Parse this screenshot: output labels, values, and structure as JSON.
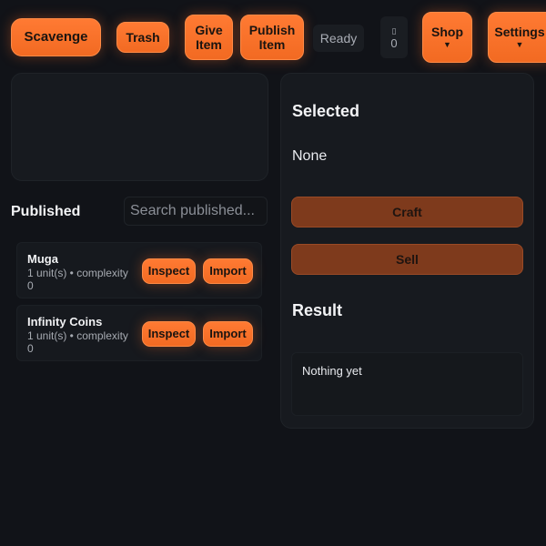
{
  "toolbar": {
    "scavenge_label": "Scavenge",
    "trash_label": "Trash",
    "give_item_line1": "Give",
    "give_item_line2": "Item",
    "publish_item_line1": "Publish",
    "publish_item_line2": "Item",
    "status_text": "Ready",
    "counter_icon_glyph": "▯",
    "counter_value": "0",
    "shop_label": "Shop",
    "settings_label": "Settings",
    "caret": "▼"
  },
  "published": {
    "title": "Published",
    "search_placeholder": "Search published...",
    "items": [
      {
        "name": "Muga",
        "meta": "1 unit(s) • complexity 0",
        "inspect_label": "Inspect",
        "import_label": "Import"
      },
      {
        "name": "Infinity Coins",
        "meta": "1 unit(s) • complexity 0",
        "inspect_label": "Inspect",
        "import_label": "Import"
      }
    ]
  },
  "selected": {
    "title": "Selected",
    "value": "None",
    "craft_label": "Craft",
    "sell_label": "Sell"
  },
  "result": {
    "title": "Result",
    "value": "Nothing yet"
  },
  "colors": {
    "accent": "#f26a22",
    "background": "#111318",
    "panel": "#171a1f",
    "action_button": "#7e3a1c"
  }
}
